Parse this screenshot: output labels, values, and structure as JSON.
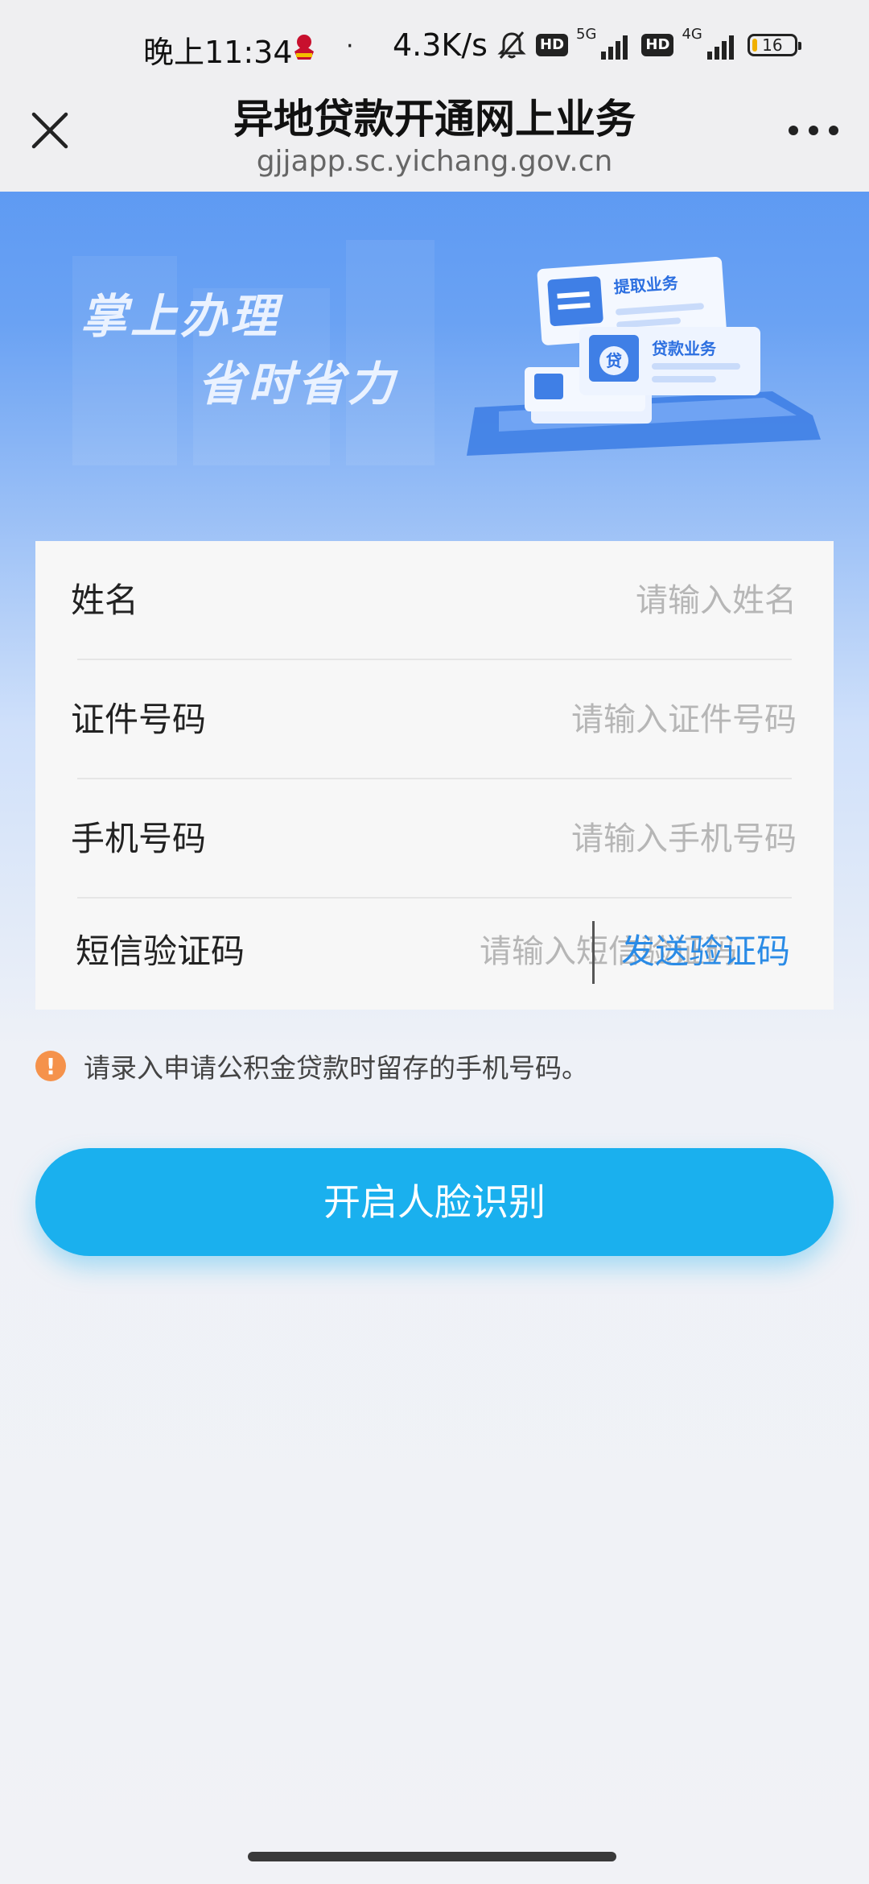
{
  "status_bar": {
    "time": "晚上11:34",
    "dot": "·",
    "speed": "4.3K/s",
    "hd_1": "HD",
    "net_1": "5G",
    "hd_2": "HD",
    "net_2": "4G",
    "battery": "16",
    "icons": [
      "app-badge-icon",
      "bell-muted-icon",
      "signal-icon",
      "signal-icon",
      "battery-icon"
    ]
  },
  "navbar": {
    "title": "异地贷款开通网上业务",
    "url": "gjjapp.sc.yichang.gov.cn",
    "close_icon": "close-icon",
    "more_icon": "more-icon"
  },
  "banner": {
    "slogan_line1": "掌上办理",
    "slogan_line2": "省时省力",
    "card_1": "提取业务",
    "card_2": "贷款业务",
    "coin_char": "贷"
  },
  "form": {
    "name_label": "姓名",
    "name_placeholder": "请输入姓名",
    "id_label": "证件号码",
    "id_placeholder": "请输入证件号码",
    "phone_label": "手机号码",
    "phone_placeholder": "请输入手机号码",
    "sms_label": "短信验证码",
    "sms_placeholder": "请输入短信验证码",
    "send_code": "发送验证码"
  },
  "hint": {
    "icon_char": "!",
    "text": "请录入申请公积金贷款时留存的手机号码。"
  },
  "primary_button": "开启人脸识别",
  "colors": {
    "banner": "#4d8ff2",
    "primary": "#1ab0ee",
    "link": "#2a8be6",
    "hint_icon": "#f5924b"
  }
}
